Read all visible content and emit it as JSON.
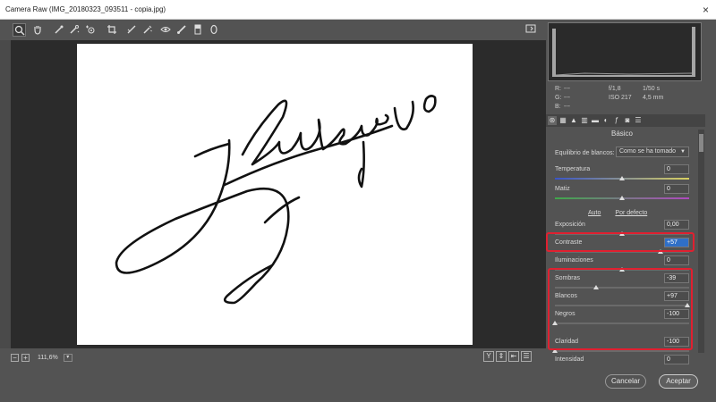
{
  "window": {
    "title": "Camera Raw (IMG_20180323_093511 - copia.jpg)",
    "close": "×"
  },
  "toolbar": {
    "tools": [
      "zoom-icon",
      "hand-icon",
      "white-balance-icon",
      "color-sampler-icon",
      "target-adjust-icon",
      "crop-icon",
      "straighten-icon",
      "spot-removal-icon",
      "redeye-icon",
      "adjustment-brush-icon",
      "graduated-filter-icon",
      "radial-filter-icon"
    ],
    "active": "zoom-icon"
  },
  "bottom": {
    "zoom": "111,6%",
    "zoom_minus": "−",
    "zoom_plus": "+",
    "view_buttons": [
      "Y",
      "⇕",
      "⇤",
      "☰"
    ]
  },
  "info": {
    "r_label": "R:",
    "g_label": "G:",
    "b_label": "B:",
    "r": "---",
    "g": "---",
    "b": "---",
    "aperture": "f/1,8",
    "shutter": "1/50 s",
    "iso": "ISO 217",
    "focal": "4,5 mm"
  },
  "panel": {
    "section": "Básico",
    "wb_label": "Equilibrio de blancos:",
    "wb_value": "Como se ha tomado",
    "auto": "Auto",
    "default": "Por defecto",
    "controls": [
      {
        "name": "Temperatura",
        "value": "0",
        "level": 0.5
      },
      {
        "name": "Matiz",
        "value": "0",
        "level": 0.5
      },
      {
        "name": "Exposición",
        "value": "0,00",
        "level": 0.5
      },
      {
        "name": "Contraste",
        "value": "+57",
        "level": 0.785
      },
      {
        "name": "Iluminaciones",
        "value": "0",
        "level": 0.5
      },
      {
        "name": "Sombras",
        "value": "-39",
        "level": 0.305
      },
      {
        "name": "Blancos",
        "value": "+97",
        "level": 0.985
      },
      {
        "name": "Negros",
        "value": "-100",
        "level": 0.0
      },
      {
        "name": "Claridad",
        "value": "-100",
        "level": 0.0
      },
      {
        "name": "Intensidad",
        "value": "0",
        "level": 0.5
      }
    ]
  },
  "buttons": {
    "cancel": "Cancelar",
    "ok": "Aceptar"
  },
  "colors": {
    "highlight": "#e02030",
    "accent": "#2f6fc7"
  }
}
